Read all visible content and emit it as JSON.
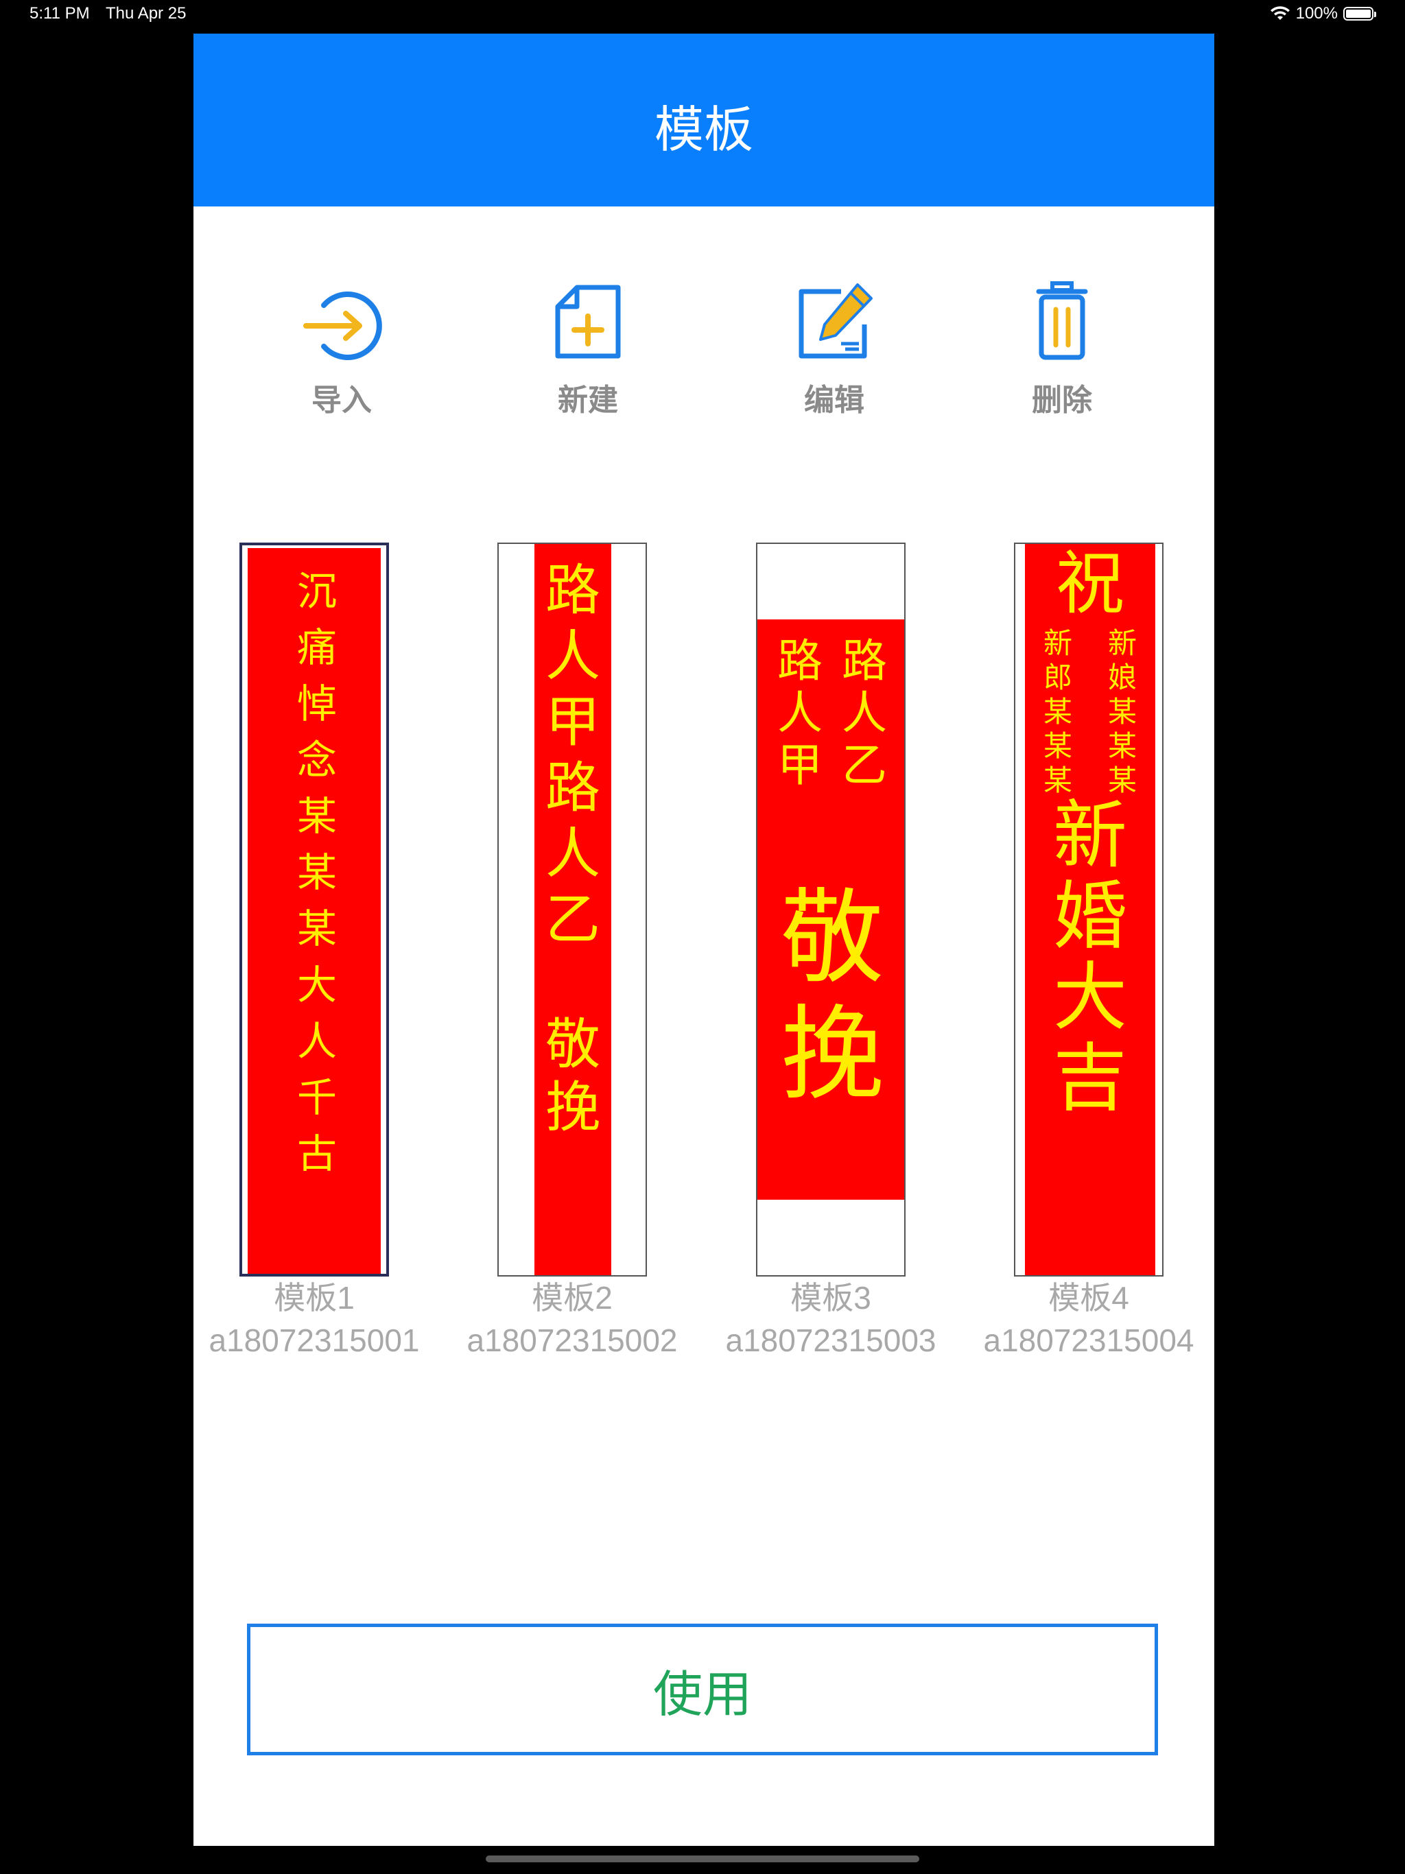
{
  "status_bar": {
    "time": "5:11 PM",
    "date": "Thu Apr 25",
    "battery": "100%",
    "battery_level": 1.0
  },
  "nav": {
    "title": "模板"
  },
  "toolbar": [
    {
      "label": "导入",
      "icon": "import-arrow-icon"
    },
    {
      "label": "新建",
      "icon": "new-file-icon"
    },
    {
      "label": "编辑",
      "icon": "edit-pencil-icon"
    },
    {
      "label": "删除",
      "icon": "trash-icon"
    }
  ],
  "templates": [
    {
      "name": "模板1",
      "code": "a18072315001",
      "selected": true,
      "text": [
        "沉",
        "痛",
        "悼",
        "念",
        "某",
        "某",
        "某",
        "大",
        "人",
        "千",
        "古"
      ]
    },
    {
      "name": "模板2",
      "code": "a18072315002",
      "selected": false,
      "text": [
        "路",
        "人",
        "甲",
        "路",
        "人",
        "乙",
        "敬",
        "挽"
      ]
    },
    {
      "name": "模板3",
      "code": "a18072315003",
      "selected": false,
      "left_col": [
        "路",
        "人",
        "甲"
      ],
      "right_col": [
        "路",
        "人",
        "乙"
      ],
      "main": [
        "敬",
        "挽"
      ]
    },
    {
      "name": "模板4",
      "code": "a18072315004",
      "selected": false,
      "top": "祝",
      "left_col": [
        "新",
        "郎",
        "某",
        "某",
        "某"
      ],
      "right_col": [
        "新",
        "娘",
        "某",
        "某",
        "某"
      ],
      "main": [
        "新",
        "婚",
        "大",
        "吉"
      ]
    }
  ],
  "use_button": {
    "label": "使用"
  },
  "colors": {
    "nav": "#0a7ffd",
    "accent_icon": "#1e7fe6",
    "icon_fill": "#f2b51c",
    "banner": "#ff0000",
    "banner_text": "#ffee00",
    "use_text": "#20a45a"
  }
}
